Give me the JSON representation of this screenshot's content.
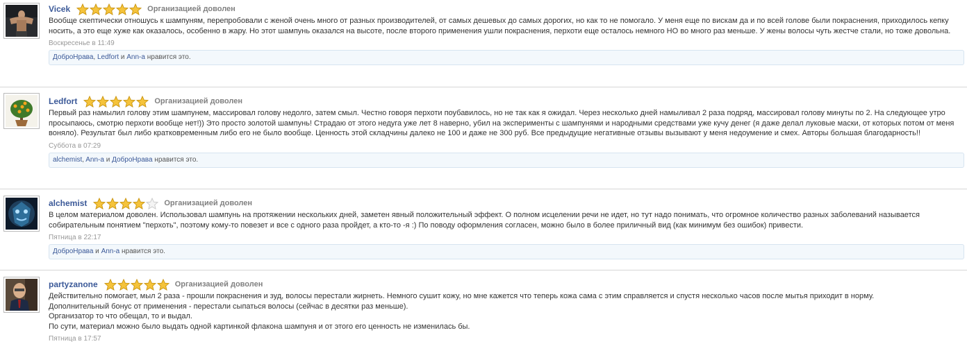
{
  "verdict_label": "Организацией доволен",
  "reviews": [
    {
      "user": "Vicek",
      "rating": 5,
      "text": "Вообще скептически отношусь к шампуням, перепробовали с женой очень много от разных производителей, от самых дешевых до самых дорогих, но как то не помогало. У меня еще по вискам да и по всей голове были покраснения, приходилось кепку носить, а это еще хуже как оказалось, особенно в жару. Но этот шампунь оказался на высоте, после второго применения ушли покраснения, перхоти еще осталось немного НО во много раз меньше. У жены волосы чуть жестче стали, но тоже довольна.",
      "time": "Воскресенье в 11:49",
      "likes": {
        "names": [
          "ДоброНрава",
          "Ledfort",
          "Ann-a"
        ],
        "sep1": ", ",
        "sep2": " и ",
        "suffix": " нравится это."
      }
    },
    {
      "user": "Ledfort",
      "rating": 5,
      "text": "Первый раз намылил голову этим шампунем, массировал голову недолго, затем смыл. Честно говоря перхоти поубавилось, но не так как я ожидал. Через несколько дней намыливал 2 раза подряд, массировал голову минуты по 2. На следующее утро просыпаюсь, смотрю перхоти вообще нет!)) Это просто золотой шампунь! Страдаю от этого недуга уже лет 8 наверно, убил на эксперименты с шампунями и народными средствами уже кучу денег (я даже делал луковые маски, от которых потом от меня воняло). Результат был либо кратковременным либо его не было вообще. Ценность этой складчины далеко не 100 и даже не 300 руб. Все предыдущие негативные отзывы вызывают у меня недоумение и смех. Авторы большая благодарность!!",
      "time": "Суббота в 07:29",
      "likes": {
        "names": [
          "alchemist",
          "Ann-a",
          "ДоброНрава"
        ],
        "sep1": ", ",
        "sep2": " и ",
        "suffix": " нравится это."
      }
    },
    {
      "user": "alchemist",
      "rating": 4,
      "text": "В целом материалом доволен. Использовал шампунь на протяжении нескольких дней, заметен явный положительный эффект. О полном исцелении речи не идет, но тут надо понимать, что огромное количество разных заболеваний называется собирательным понятием \"перхоть\", поэтому кому-то повезет и все с одного раза пройдет, а кто-то -я :) По поводу оформления согласен, можно было в более приличный вид (как минимум без ошибок) привести.",
      "time": "Пятница в 22:17",
      "likes": {
        "names": [
          "ДоброНрава",
          "Ann-a"
        ],
        "sep1": " и ",
        "suffix": " нравится это."
      }
    },
    {
      "user": "partyzanone",
      "rating": 5,
      "lines": [
        "Действительно помогает, мыл 2 раза - прошли покраснения и зуд, волосы перестали жирнеть. Немного сушит кожу, но мне кажется что теперь кожа сама с этим справляется и спустя несколько часов после мытья приходит в норму.",
        "Дополнительный бонус от применения - перестали сыпаться волосы (сейчас в десятки раз меньше).",
        "Организатор то что обещал, то и выдал.",
        "По сути, материал можно было выдать одной картинкой флакона шампуня и от этого его ценность не изменилась бы."
      ],
      "time": "Пятница в 17:57"
    }
  ]
}
